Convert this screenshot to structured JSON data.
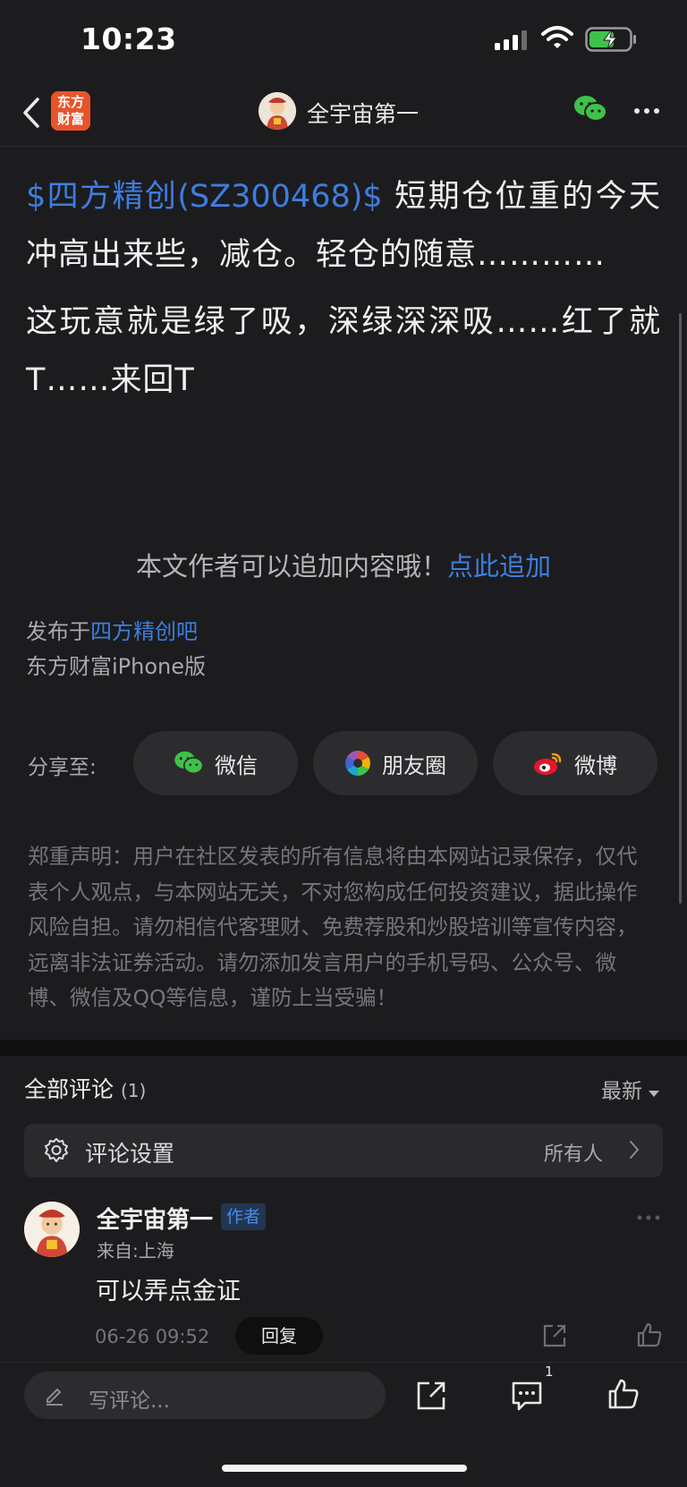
{
  "status_bar": {
    "time": "10:23"
  },
  "nav": {
    "logo_line1": "东方",
    "logo_line2": "财富",
    "username": "全宇宙第一"
  },
  "article": {
    "stock_tag": "$四方精创(SZ300468)$",
    "para1_rest": " 短期仓位重的今天冲高出来些，减仓。轻仓的随意…………",
    "para2": "这玩意就是绿了吸，深绿深深吸……红了就T……来回T"
  },
  "append": {
    "hint": "本文作者可以追加内容哦！",
    "link": "点此追加"
  },
  "publish": {
    "prefix": "发布于",
    "bar": "四方精创吧",
    "client": "东方财富iPhone版"
  },
  "share": {
    "label": "分享至:",
    "buttons": [
      {
        "label": "微信",
        "icon": "wechat-icon"
      },
      {
        "label": "朋友圈",
        "icon": "moments-icon"
      },
      {
        "label": "微博",
        "icon": "weibo-icon"
      }
    ]
  },
  "disclaimer": "郑重声明：用户在社区发表的所有信息将由本网站记录保存，仅代表个人观点，与本网站无关，不对您构成任何投资建议，据此操作风险自担。请勿相信代客理财、免费荐股和炒股培训等宣传内容，远离非法证券活动。请勿添加发言用户的手机号码、公众号、微博、微信及QQ等信息，谨防上当受骗！",
  "comments": {
    "title": "全部评论",
    "count": "(1)",
    "sort": "最新",
    "settings_label": "评论设置",
    "settings_value": "所有人",
    "items": [
      {
        "name": "全宇宙第一",
        "badge": "作者",
        "location": "来自:上海",
        "text": "可以弄点金证",
        "time": "06-26 09:52",
        "reply": "回复"
      }
    ]
  },
  "bottom_bar": {
    "placeholder": "写评论...",
    "comment_count": "1"
  },
  "colors": {
    "link": "#3e7de0",
    "background": "#1c1c1e",
    "wechat_green": "#3fc24a"
  }
}
